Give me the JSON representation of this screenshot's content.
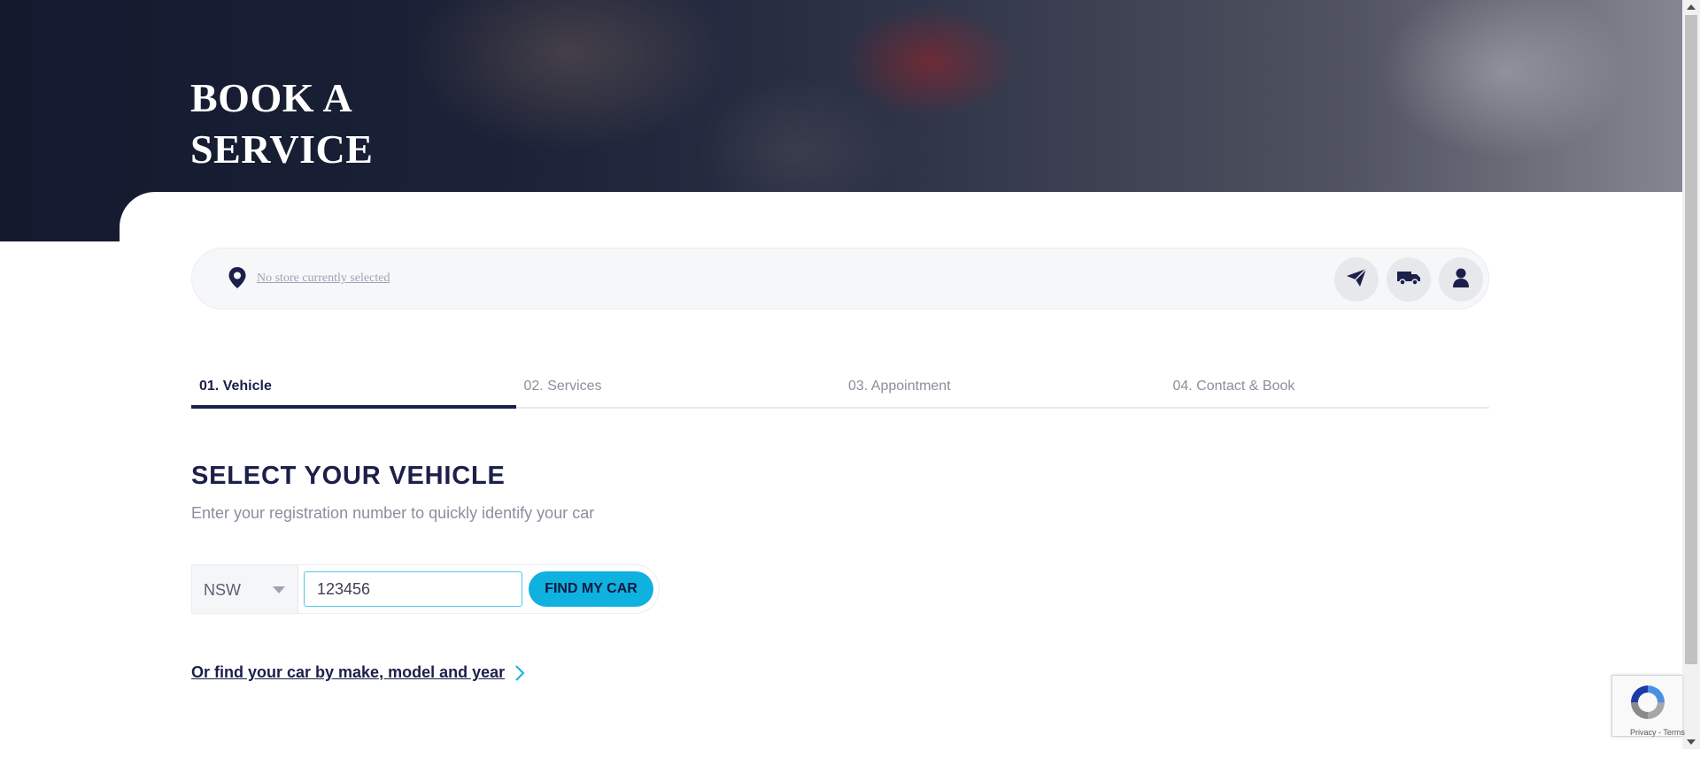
{
  "hero": {
    "title": "BOOK A SERVICE"
  },
  "store_bar": {
    "store_text": "No store currently selected",
    "icons": [
      "location-pin-icon",
      "paper-plane-icon",
      "truck-icon",
      "user-icon"
    ]
  },
  "steps": [
    {
      "label": "01. Vehicle",
      "active": true
    },
    {
      "label": "02. Services",
      "active": false
    },
    {
      "label": "03. Appointment",
      "active": false
    },
    {
      "label": "04. Contact & Book",
      "active": false
    }
  ],
  "vehicle": {
    "title": "SELECT YOUR VEHICLE",
    "subtitle": "Enter your registration number to quickly identify your car",
    "state_selected": "NSW",
    "registration_value": "123456",
    "find_button": "FIND MY CAR",
    "alt_link": "Or find your car by make, model and year"
  },
  "recaptcha": {
    "terms": "Privacy - Terms"
  },
  "colors": {
    "brand_navy": "#1c1f4a",
    "accent_cyan": "#0fb1df",
    "muted_text": "#8b8f9c"
  }
}
